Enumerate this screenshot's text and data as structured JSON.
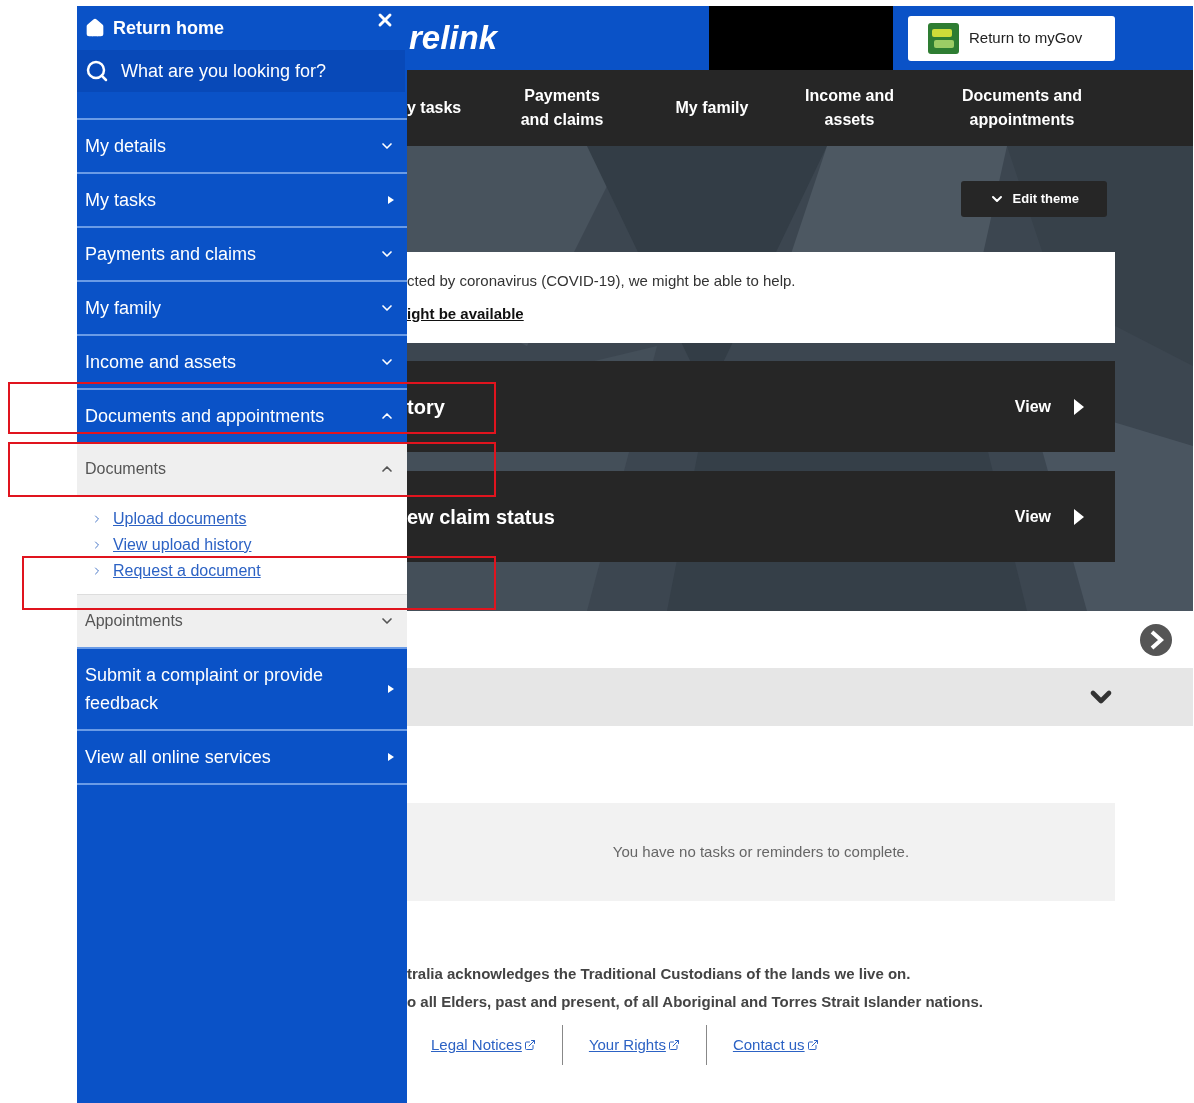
{
  "sidebar": {
    "return_home": "Return home",
    "search": {
      "placeholder": "What are you looking for?"
    },
    "items": [
      {
        "label": "My details",
        "kind": "dropdown",
        "expanded": false,
        "highlighted": false
      },
      {
        "label": "My tasks",
        "kind": "link",
        "highlighted": false
      },
      {
        "label": "Payments and claims",
        "kind": "dropdown",
        "expanded": false,
        "highlighted": false
      },
      {
        "label": "My family",
        "kind": "dropdown",
        "expanded": false,
        "highlighted": false
      },
      {
        "label": "Income and assets",
        "kind": "dropdown",
        "expanded": false,
        "highlighted": false
      },
      {
        "label": "Documents and appointments",
        "kind": "dropdown",
        "expanded": true,
        "highlighted": true,
        "children": [
          {
            "label": "Documents",
            "expanded": true,
            "highlighted": true,
            "links": [
              {
                "label": "Upload documents",
                "highlighted": false
              },
              {
                "label": "View upload history",
                "highlighted": false
              },
              {
                "label": "Request a document",
                "highlighted": true
              }
            ]
          },
          {
            "label": "Appointments",
            "expanded": false,
            "highlighted": false
          }
        ]
      },
      {
        "label": "Submit a complaint or provide feedback",
        "kind": "link",
        "highlighted": false
      },
      {
        "label": "View all online services",
        "kind": "link",
        "highlighted": false
      }
    ]
  },
  "header": {
    "logo": "relink",
    "return_button": "Return to myGov"
  },
  "nav": [
    "y tasks",
    "Payments and claims",
    "My family",
    "Income and assets",
    "Documents and appointments"
  ],
  "hero": {
    "edit_theme": "Edit theme",
    "notice": {
      "text": "cted by coronavirus (COVID-19), we might be able to help.",
      "link": "ight be available"
    },
    "cards": [
      {
        "title": "tory",
        "action": "View"
      },
      {
        "title": "ew claim status",
        "action": "View"
      }
    ]
  },
  "tasks_message": "You have no tasks or reminders to complete.",
  "footer": {
    "lines": [
      "tralia acknowledges the Traditional Custodians of the lands we live on.",
      "o all Elders, past and present, of all Aboriginal and Torres Strait Islander nations."
    ],
    "links": [
      "Legal Notices",
      "Your Rights",
      "Contact us"
    ]
  }
}
